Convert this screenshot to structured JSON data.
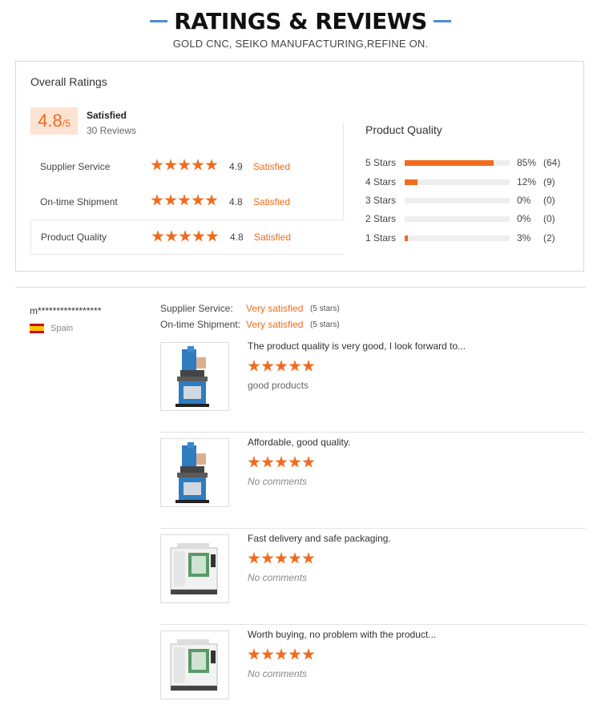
{
  "header": {
    "title": "RATINGS & REVIEWS",
    "subtitle": "GOLD CNC, SEIKO MANUFACTURING,REFINE ON."
  },
  "overall": {
    "title": "Overall Ratings",
    "score": "4.8",
    "score_suffix": "/5",
    "label": "Satisfied",
    "reviews": "30 Reviews"
  },
  "metrics": [
    {
      "name": "Supplier Service",
      "score": "4.9",
      "status": "Satisfied",
      "stars": 5
    },
    {
      "name": "On-time Shipment",
      "score": "4.8",
      "status": "Satisfied",
      "stars": 5
    },
    {
      "name": "Product Quality",
      "score": "4.8",
      "status": "Satisfied",
      "stars": 5
    }
  ],
  "product_quality": {
    "title": "Product Quality",
    "rows": [
      {
        "label": "5 Stars",
        "percent": 85,
        "percent_text": "85%",
        "count": "(64)"
      },
      {
        "label": "4 Stars",
        "percent": 12,
        "percent_text": "12%",
        "count": "(9)"
      },
      {
        "label": "3 Stars",
        "percent": 0,
        "percent_text": "0%",
        "count": "(0)"
      },
      {
        "label": "2 Stars",
        "percent": 0,
        "percent_text": "0%",
        "count": "(0)"
      },
      {
        "label": "1 Stars",
        "percent": 3,
        "percent_text": "3%",
        "count": "(2)"
      }
    ]
  },
  "reviewer": {
    "name": "m*****************",
    "country": "Spain",
    "supplier_service_label": "Supplier Service:",
    "supplier_service_value": "Very satisfied",
    "supplier_service_stars": "(5 stars)",
    "shipment_label": "On-time Shipment:",
    "shipment_value": "Very satisfied",
    "shipment_stars": "(5 stars)"
  },
  "reviews": [
    {
      "text": "The product quality is very good, I look forward to...",
      "stars": 5,
      "comment": "good products",
      "image": "vertical-mill-machine"
    },
    {
      "text": "Affordable, good quality.",
      "stars": 5,
      "comment": "No comments",
      "image": "vertical-mill-machine"
    },
    {
      "text": "Fast delivery and safe packaging.",
      "stars": 5,
      "comment": "No comments",
      "image": "cnc-machining-center"
    },
    {
      "text": "Worth buying, no problem with the product...",
      "stars": 5,
      "comment": "No comments",
      "image": "cnc-machining-center"
    }
  ],
  "colors": {
    "accent": "#f06b1d",
    "header_line": "#4a8fd0",
    "badge_bg": "#fde3d3"
  }
}
